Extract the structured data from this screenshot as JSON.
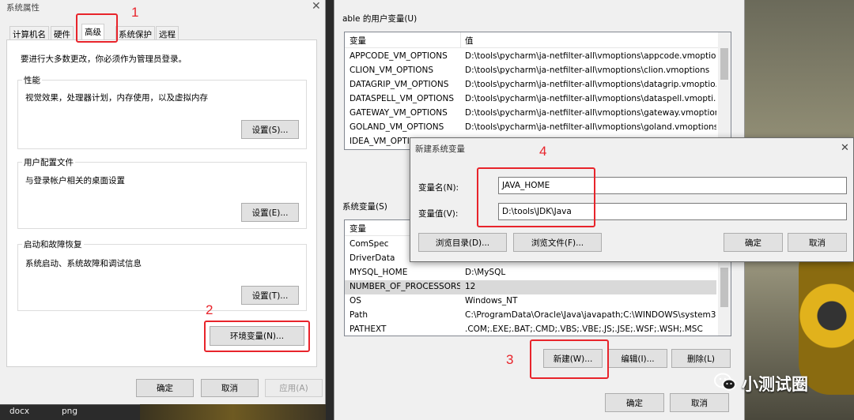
{
  "left_dialog": {
    "title": "系统属性",
    "tabs": [
      "计算机名",
      "硬件",
      "高级",
      "系统保护",
      "远程"
    ],
    "admin_notice": "要进行大多数更改，你必须作为管理员登录。",
    "performance": {
      "label": "性能",
      "desc": "视觉效果，处理器计划，内存使用，以及虚拟内存",
      "button": "设置(S)..."
    },
    "user_profiles": {
      "label": "用户配置文件",
      "desc": "与登录帐户相关的桌面设置",
      "button": "设置(E)..."
    },
    "startup": {
      "label": "启动和故障恢复",
      "desc": "系统启动、系统故障和调试信息",
      "button": "设置(T)..."
    },
    "env_button": "环境变量(N)...",
    "ok": "确定",
    "cancel": "取消",
    "apply": "应用(A)"
  },
  "env_dialog": {
    "user_vars_label": "able 的用户变量(U)",
    "col_var": "变量",
    "col_val": "值",
    "user_vars": [
      {
        "name": "APPCODE_VM_OPTIONS",
        "value": "D:\\tools\\pycharm\\ja-netfilter-all\\vmoptions\\appcode.vmoptio..."
      },
      {
        "name": "CLION_VM_OPTIONS",
        "value": "D:\\tools\\pycharm\\ja-netfilter-all\\vmoptions\\clion.vmoptions"
      },
      {
        "name": "DATAGRIP_VM_OPTIONS",
        "value": "D:\\tools\\pycharm\\ja-netfilter-all\\vmoptions\\datagrip.vmoptio..."
      },
      {
        "name": "DATASPELL_VM_OPTIONS",
        "value": "D:\\tools\\pycharm\\ja-netfilter-all\\vmoptions\\dataspell.vmopti..."
      },
      {
        "name": "GATEWAY_VM_OPTIONS",
        "value": "D:\\tools\\pycharm\\ja-netfilter-all\\vmoptions\\gateway.vmoptions"
      },
      {
        "name": "GOLAND_VM_OPTIONS",
        "value": "D:\\tools\\pycharm\\ja-netfilter-all\\vmoptions\\goland.vmoptions"
      },
      {
        "name": "IDEA_VM_OPTI",
        "value": ""
      }
    ],
    "sys_vars_label": "系统变量(S)",
    "sys_vars": [
      {
        "name": "ComSpec",
        "value": ""
      },
      {
        "name": "DriverData",
        "value": ""
      },
      {
        "name": "MYSQL_HOME",
        "value": "D:\\MySQL"
      },
      {
        "name": "NUMBER_OF_PROCESSORS",
        "value": "12"
      },
      {
        "name": "OS",
        "value": "Windows_NT"
      },
      {
        "name": "Path",
        "value": "C:\\ProgramData\\Oracle\\Java\\javapath;C:\\WINDOWS\\system3..."
      },
      {
        "name": "PATHEXT",
        "value": ".COM;.EXE;.BAT;.CMD;.VBS;.VBE;.JS;.JSE;.WSF;.WSH;.MSC"
      }
    ],
    "new_button": "新建(W)...",
    "edit_button": "编辑(I)...",
    "delete_button": "删除(L)",
    "ok": "确定",
    "cancel": "取消"
  },
  "new_var_dialog": {
    "title": "新建系统变量",
    "name_label": "变量名(N):",
    "name_value": "JAVA_HOME",
    "value_label": "变量值(V):",
    "value_value": "D:\\tools\\JDK\\Java",
    "browse_dir": "浏览目录(D)...",
    "browse_file": "浏览文件(F)...",
    "ok": "确定",
    "cancel": "取消"
  },
  "annotations": [
    "1",
    "2",
    "3",
    "4"
  ],
  "taskbar": [
    "docx",
    "png"
  ],
  "watermark": "小测试圈"
}
